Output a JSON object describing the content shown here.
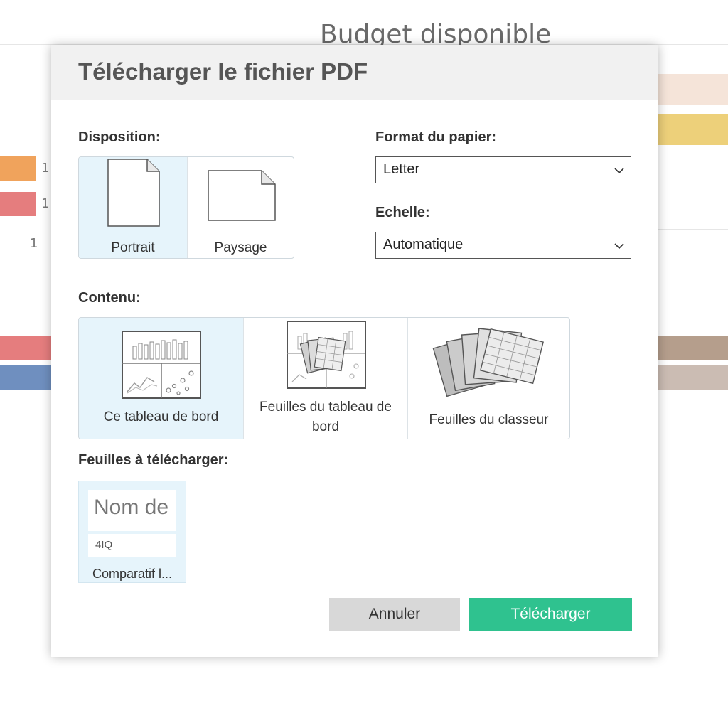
{
  "background": {
    "title": "Budget disponible",
    "row_numbers": [
      "1",
      "1",
      "1"
    ],
    "colors": {
      "orange": "#f0a35c",
      "red": "#e57d7e",
      "blue": "#6f8fbf",
      "peach": "#f5e4d9",
      "gold": "#edd07a",
      "brown": "#b59e8c",
      "taupe": "#cbbcb3"
    }
  },
  "dialog": {
    "title": "Télécharger le fichier PDF",
    "layout": {
      "label": "Disposition:",
      "options": [
        {
          "label": "Portrait",
          "icon": "portrait-page-icon",
          "selected": true
        },
        {
          "label": "Paysage",
          "icon": "landscape-page-icon",
          "selected": false
        }
      ]
    },
    "paper": {
      "label": "Format du papier:",
      "value": "Letter"
    },
    "scale": {
      "label": "Echelle:",
      "value": "Automatique"
    },
    "content": {
      "label": "Contenu:",
      "options": [
        {
          "label": "Ce tableau de bord",
          "icon": "dashboard-icon",
          "selected": true
        },
        {
          "label_line1": "Feuilles du tableau de",
          "label_line2": "bord",
          "icon": "dashboard-sheets-icon",
          "selected": false
        },
        {
          "label": "Feuilles du classeur",
          "icon": "workbook-sheets-icon",
          "selected": false
        }
      ]
    },
    "sheets": {
      "label": "Feuilles à télécharger:",
      "items": [
        {
          "preview_title": "Nom de",
          "preview_sub": "4IQ",
          "caption": "Comparatif l..."
        }
      ]
    },
    "buttons": {
      "cancel": "Annuler",
      "download": "Télécharger"
    },
    "colors": {
      "accent": "#2fc28f",
      "selected_bg": "#e6f4fb",
      "header_bg": "#f1f1f1"
    }
  }
}
